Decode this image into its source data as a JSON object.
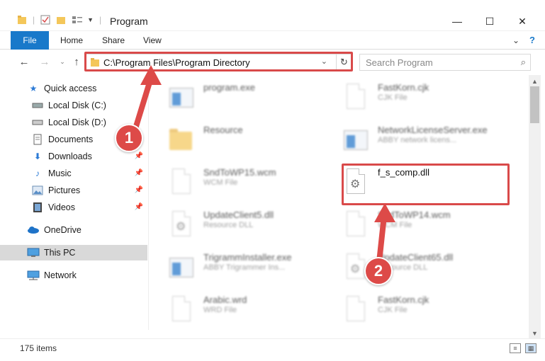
{
  "window": {
    "title": "Program",
    "controls": {
      "minimize": "—",
      "maximize": "☐",
      "close": "✕"
    }
  },
  "ribbon": {
    "tabs": [
      "File",
      "Home",
      "Share",
      "View"
    ]
  },
  "address": {
    "path": "C:\\Program Files\\Program Directory",
    "search_placeholder": "Search Program"
  },
  "nav": {
    "items": [
      {
        "label": "Quick access",
        "icon": "star-icon"
      },
      {
        "label": "Local Disk (C:)",
        "icon": "drive-icon"
      },
      {
        "label": "Local Disk (D:)",
        "icon": "drive-icon"
      },
      {
        "label": "Documents",
        "icon": "documents-icon"
      },
      {
        "label": "Downloads",
        "icon": "download-icon"
      },
      {
        "label": "Music",
        "icon": "music-icon"
      },
      {
        "label": "Pictures",
        "icon": "pictures-icon"
      },
      {
        "label": "Videos",
        "icon": "videos-icon"
      },
      {
        "label": "OneDrive",
        "icon": "cloud-icon"
      },
      {
        "label": "This PC",
        "icon": "computer-icon"
      },
      {
        "label": "Network",
        "icon": "network-icon"
      }
    ]
  },
  "files": [
    {
      "name": "program.exe",
      "type": ""
    },
    {
      "name": "FastKorn.cjk",
      "type": "CJK File"
    },
    {
      "name": "Resource",
      "type": ""
    },
    {
      "name": "NetworkLicenseServer.exe",
      "type": "ABBY network licens..."
    },
    {
      "name": "SndToWP15.wcm",
      "type": "WCM File"
    },
    {
      "name": "f_s_comp.dll",
      "type": ""
    },
    {
      "name": "UpdateClient5.dll",
      "type": "Resource DLL"
    },
    {
      "name": "SndToWP14.wcm",
      "type": "WCM File"
    },
    {
      "name": "TrigrammInstaller.exe",
      "type": "ABBY Trigrammer Ins..."
    },
    {
      "name": "UpdateClient65.dll",
      "type": "Resource DLL"
    },
    {
      "name": "Arabic.wrd",
      "type": "WRD File"
    },
    {
      "name": "FastKorn.cjk",
      "type": "CJK File"
    }
  ],
  "status": {
    "count": "175 items"
  },
  "annotations": {
    "step1": "1",
    "step2": "2",
    "accent": "#dd4a48"
  }
}
